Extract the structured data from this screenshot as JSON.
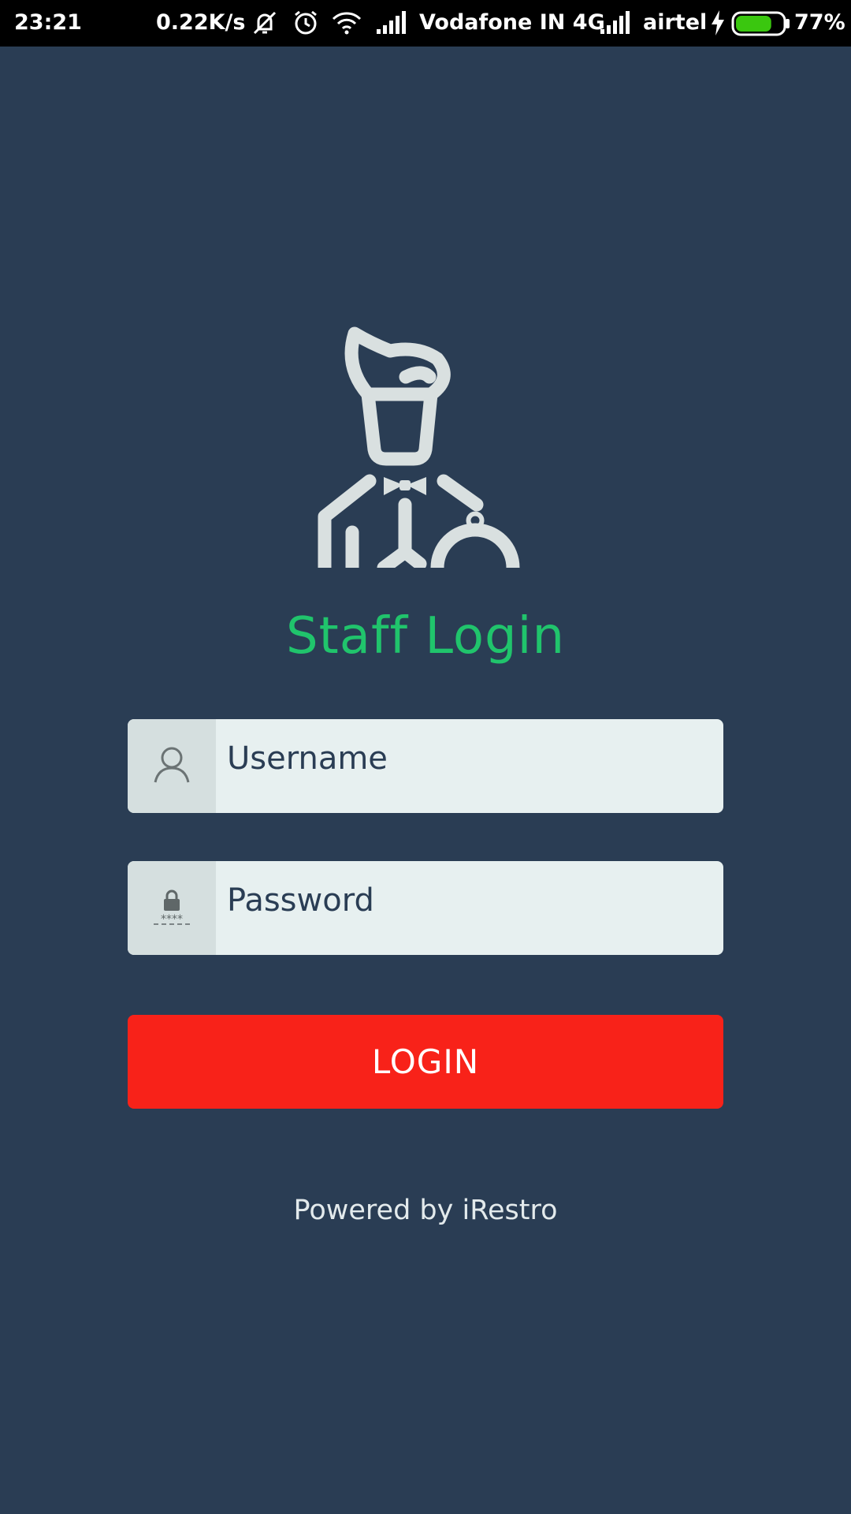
{
  "status_bar": {
    "time": "23:21",
    "net_speed": "0.22K/s",
    "carrier_1": "Vodafone IN 4G",
    "carrier_2": "airtel",
    "battery_percent": "77%",
    "battery_level": 0.77,
    "icons": [
      "mute-notification-icon",
      "alarm-icon",
      "wifi-icon",
      "signal-icon",
      "signal-icon",
      "charging-icon",
      "battery-icon"
    ]
  },
  "app": {
    "logo_icon": "waiter-icon",
    "title": "Staff Login",
    "username": {
      "placeholder": "Username",
      "icon": "user-icon"
    },
    "password": {
      "placeholder": "Password",
      "icon": "lock-icon",
      "icon_mask": "****"
    },
    "login_label": "LOGIN",
    "footer": "Powered by iRestro"
  },
  "colors": {
    "background": "#2a3d54",
    "title": "#20c46c",
    "button": "#f82219",
    "field": "#e7f0f0",
    "field_icon_bg": "#d5dfdf",
    "logo": "#d9e0e0"
  }
}
